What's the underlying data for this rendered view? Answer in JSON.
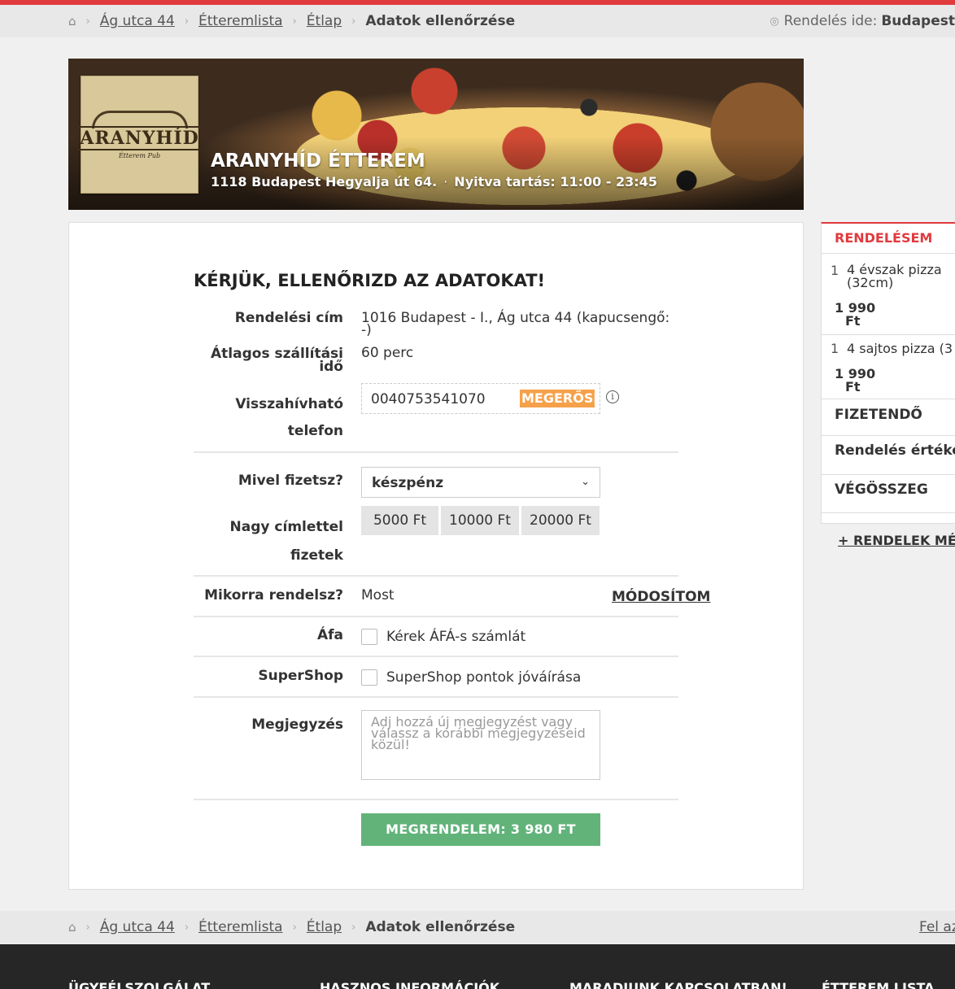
{
  "breadcrumb": {
    "items": [
      "Ág utca 44",
      "Étteremlista",
      "Étlap"
    ],
    "current": "Adatok ellenőrzése"
  },
  "delivery": {
    "label": "Rendelés ide:",
    "city": "Budapest"
  },
  "back_to_top": "Fel az",
  "restaurant": {
    "name": "ARANYHÍD ÉTTEREM",
    "address": "1118 Budapest Hegyalja út 64.",
    "hours": "Nyitva tartás: 11:00 - 23:45",
    "logo_text": "ARANYHÍD",
    "logo_sub": "Étterem Pub"
  },
  "form": {
    "title": "KÉRJÜK, ELLENŐRIZD AZ ADATOKAT!",
    "address_label": "Rendelési cím",
    "address_value": "1016 Budapest - I., Ág utca 44 (kapucsengő: -)",
    "time_label": "Átlagos szállítási idő",
    "time_value": "60 perc",
    "phone_label": "Visszahívható telefon",
    "phone_value": "0040753541070",
    "phone_confirm": "MEGERŐSÍTEM",
    "pay_label": "Mivel fizetsz?",
    "pay_value": "készpénz",
    "notes_label": "Nagy címlettel fizetek",
    "notes": [
      "5000 Ft",
      "10000 Ft",
      "20000 Ft"
    ],
    "when_label": "Mikorra rendelsz?",
    "when_value": "Most",
    "when_modify": "MÓDOSÍTOM",
    "vat_label": "Áfa",
    "vat_text": "Kérek ÁFÁ-s számlát",
    "supershop_label": "SuperShop",
    "supershop_text": "SuperShop pontok jóváírása",
    "comment_label": "Megjegyzés",
    "comment_placeholder": "Adj hozzá új megjegyzést vagy válassz a korábbi megjegyzéseid közül!",
    "submit": "MEGRENDELEM: 3 980 FT"
  },
  "order": {
    "title": "RENDELÉSEM",
    "items": [
      {
        "qty": "1",
        "name": "4 évszak pizza (32cm)",
        "price": "1 990",
        "currency": "Ft"
      },
      {
        "qty": "1",
        "name": "4 sajtos pizza (3",
        "price": "1 990",
        "currency": "Ft"
      }
    ],
    "payable": "FIZETENDŐ",
    "order_value": "Rendelés értéke",
    "total": "VÉGÖSSZEG",
    "more": "+ RENDELEK MÉ"
  },
  "footer": {
    "headings": [
      "ÜGYFÉLSZOLGÁLAT",
      "HASZNOS INFORMÁCIÓK",
      "MARADJUNK KAPCSOLATBAN!",
      "ÉTTEREM LISTA"
    ]
  }
}
